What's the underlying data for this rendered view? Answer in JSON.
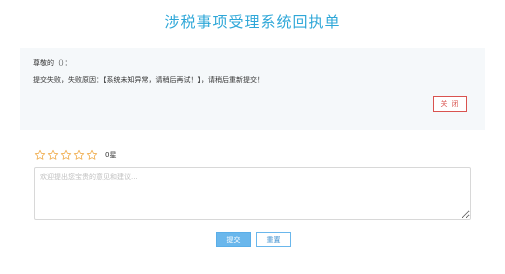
{
  "header": {
    "title": "涉税事项受理系统回执单"
  },
  "receipt": {
    "greeting": "尊敬的（）：",
    "message": "提交失败，失败原因：【系统未知异常，请稍后再试！】，请稍后重新提交！",
    "close_label": "关 闭"
  },
  "rating": {
    "stars": [
      {
        "icon": "star-outline-icon",
        "filled": false
      },
      {
        "icon": "star-outline-icon",
        "filled": false
      },
      {
        "icon": "star-outline-icon",
        "filled": false
      },
      {
        "icon": "star-outline-icon",
        "filled": false
      },
      {
        "icon": "star-outline-icon",
        "filled": false
      }
    ],
    "value": 0,
    "max": 5,
    "score_label": "0星",
    "star_color": "#f0ad4e"
  },
  "comment": {
    "value": "",
    "placeholder": "欢迎提出您宝贵的意见和建议..."
  },
  "actions": {
    "submit_label": "提交",
    "reset_label": "重置"
  },
  "colors": {
    "title": "#2ea7d8",
    "close_border": "#d9534f",
    "submit_bg": "#6ab7ec",
    "panel_bg": "#f5f8fa"
  }
}
